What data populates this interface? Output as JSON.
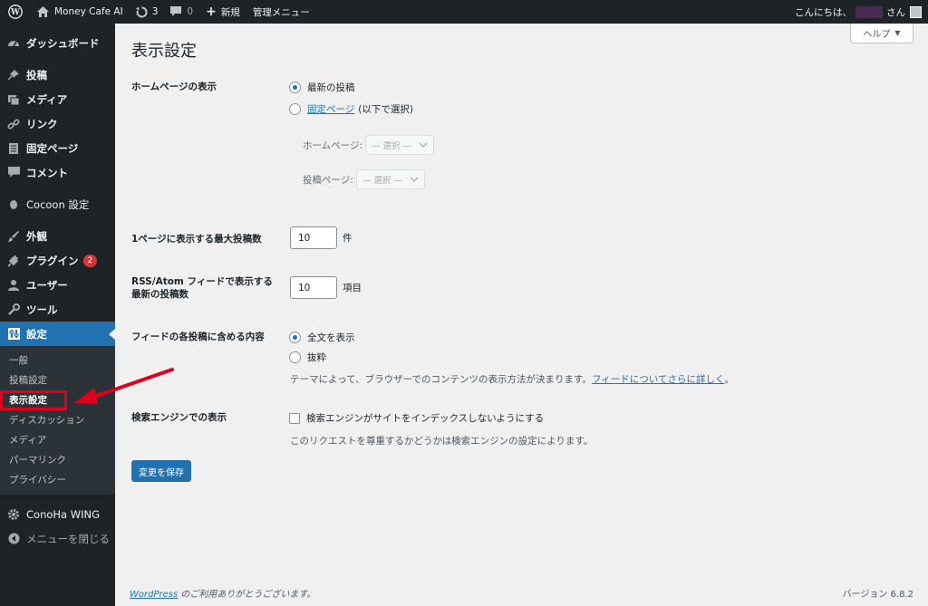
{
  "adminbar": {
    "site_name": "Money Cafe AI",
    "updates_count": "3",
    "comments_count": "0",
    "new_label": "新規",
    "admin_menu_label": "管理メニュー",
    "greeting_prefix": "こんにちは、",
    "greeting_suffix": "さん"
  },
  "sidebar": {
    "items": [
      {
        "label": "ダッシュボード",
        "icon": "dashboard-icon"
      },
      {
        "label": "投稿",
        "icon": "pin-icon"
      },
      {
        "label": "メディア",
        "icon": "media-icon"
      },
      {
        "label": "リンク",
        "icon": "link-icon"
      },
      {
        "label": "固定ページ",
        "icon": "page-icon"
      },
      {
        "label": "コメント",
        "icon": "comment-icon"
      },
      {
        "label": "Cocoon 設定",
        "icon": "cocoon-icon"
      },
      {
        "label": "外観",
        "icon": "brush-icon"
      },
      {
        "label": "プラグイン",
        "icon": "plugin-icon",
        "badge": "2"
      },
      {
        "label": "ユーザー",
        "icon": "user-icon"
      },
      {
        "label": "ツール",
        "icon": "wrench-icon"
      },
      {
        "label": "設定",
        "icon": "settings-icon"
      }
    ],
    "submenu": [
      "一般",
      "投稿設定",
      "表示設定",
      "ディスカッション",
      "メディア",
      "パーマリンク",
      "プライバシー"
    ],
    "extra": [
      {
        "label": "ConoHa WING",
        "icon": "gear-icon"
      },
      {
        "label": "メニューを閉じる",
        "icon": "collapse-icon"
      }
    ]
  },
  "main": {
    "title": "表示設定",
    "help_label": "ヘルプ",
    "homepage": {
      "label": "ホームページの表示",
      "option_latest": "最新の投稿",
      "option_static_link": "固定ページ",
      "option_static_suffix": "(以下で選択)",
      "homepage_select_label": "ホームページ:",
      "posts_select_label": "投稿ページ:",
      "select_placeholder": "— 選択 —"
    },
    "posts_per_page": {
      "label": "1ページに表示する最大投稿数",
      "value": "10",
      "unit": "件"
    },
    "rss_items": {
      "label_line1": "RSS/Atom フィードで表示する",
      "label_line2": "最新の投稿数",
      "value": "10",
      "unit": "項目"
    },
    "feed_content": {
      "label": "フィードの各投稿に含める内容",
      "option_full": "全文を表示",
      "option_excerpt": "抜粋",
      "desc_text": "テーマによって、ブラウザーでのコンテンツの表示方法が決まります。",
      "desc_link": "フィードについてさらに詳しく",
      "desc_end": "。"
    },
    "search_visibility": {
      "label": "検索エンジンでの表示",
      "checkbox_label": "検索エンジンがサイトをインデックスしないようにする",
      "desc": "このリクエストを尊重するかどうかは検索エンジンの設定によります。"
    },
    "save_label": "変更を保存"
  },
  "footer": {
    "wp_link": "WordPress",
    "thanks": " のご利用ありがとうございます。",
    "version": "バージョン 6.8.2"
  },
  "colors": {
    "accent": "#2271b1",
    "sidebar_bg": "#1d2327",
    "annotation": "#e0001b"
  }
}
